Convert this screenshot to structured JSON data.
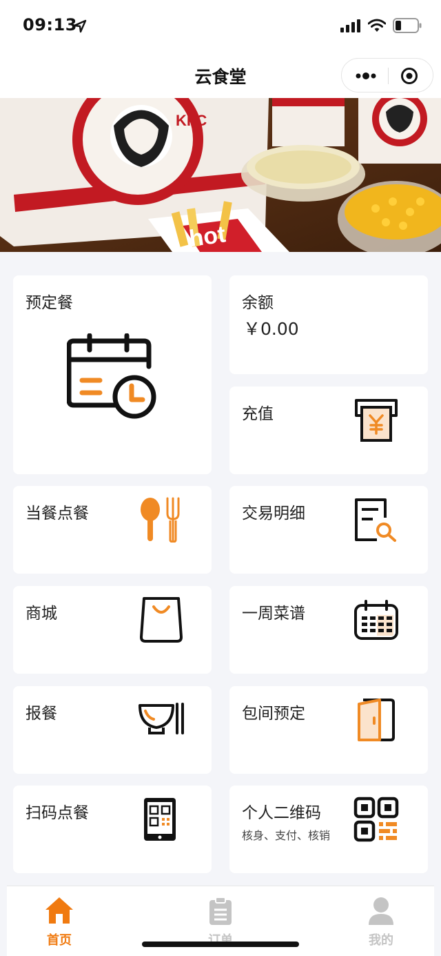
{
  "status_bar": {
    "time": "09:13"
  },
  "nav": {
    "title": "云食堂"
  },
  "cards": {
    "preorder": {
      "title": "预定餐",
      "icon": "calendar-clock-icon"
    },
    "balance": {
      "title": "余额",
      "amount": "￥0.00"
    },
    "recharge": {
      "title": "充值",
      "icon": "atm-yen-icon"
    },
    "same_meal": {
      "title": "当餐点餐",
      "icon": "spoon-fork-icon"
    },
    "transactions": {
      "title": "交易明细",
      "icon": "document-search-icon"
    },
    "mall": {
      "title": "商城",
      "icon": "shopping-bag-icon"
    },
    "weekly_menu": {
      "title": "一周菜谱",
      "icon": "calendar-grid-icon"
    },
    "report_meal": {
      "title": "报餐",
      "icon": "bowl-chopsticks-icon"
    },
    "private_room": {
      "title": "包间预定",
      "icon": "door-icon"
    },
    "scan_order": {
      "title": "扫码点餐",
      "icon": "phone-qr-icon"
    },
    "personal_qr": {
      "title": "个人二维码",
      "subtitle": "核身、支付、核销",
      "icon": "qr-code-icon"
    }
  },
  "tabs": [
    {
      "label": "首页",
      "icon": "home-icon",
      "active": true
    },
    {
      "label": "订单",
      "icon": "clipboard-icon",
      "active": false
    },
    {
      "label": "我的",
      "icon": "user-icon",
      "active": false
    }
  ],
  "colors": {
    "accent": "#f08a24",
    "active_tab": "#f07a10",
    "inactive_tab": "#c4c4c4",
    "background": "#f4f5f9"
  }
}
